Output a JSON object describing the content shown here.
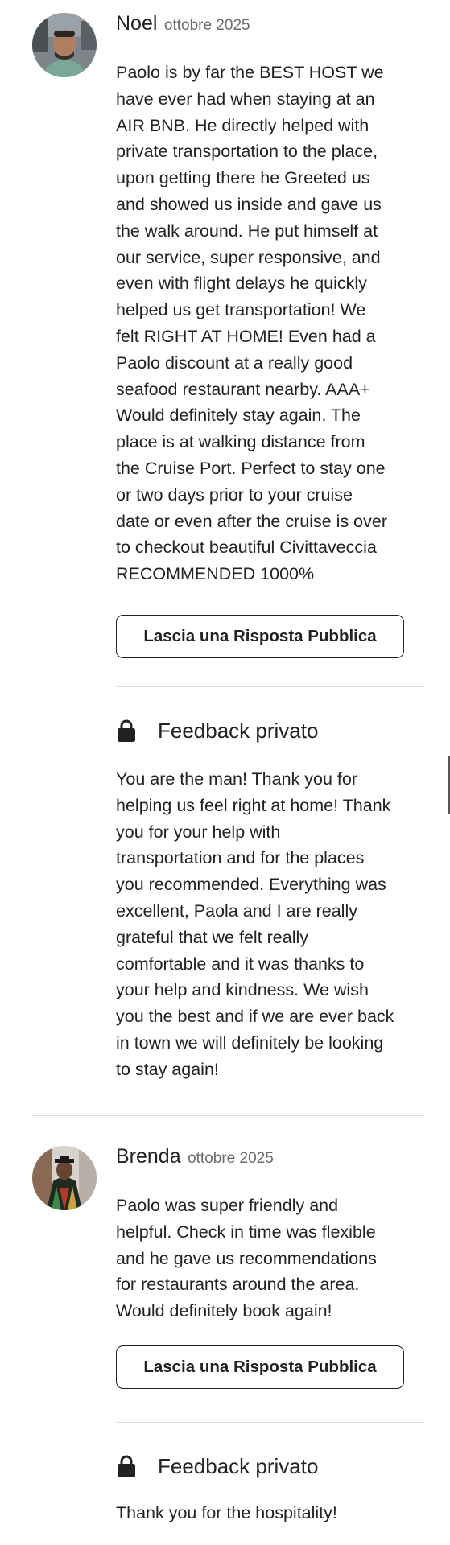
{
  "reviews": [
    {
      "reviewer": "Noel",
      "date": "ottobre 2025",
      "text": "Paolo is by far the BEST HOST we\nhave ever had when staying at an\nAIR BNB. He directly helped with\nprivate transportation to the place,\nupon getting there he Greeted us\nand showed us inside and gave us\nthe walk around. He put himself at\nour service, super responsive, and\neven with flight delays he quickly\nhelped us get transportation! We\nfelt RIGHT AT HOME! Even had a\nPaolo discount at a really good\nseafood restaurant nearby. AAA+\nWould definitely stay again. The\nplace is at walking distance from\nthe Cruise Port. Perfect to stay one\nor two days prior to your cruise\ndate or even after the cruise is over\nto checkout beautiful Civittaveccia\nRECOMMENDED 1000%",
      "reply_button": "Lascia una Risposta Pubblica",
      "private_feedback_title": "Feedback privato",
      "private_feedback": "You are the man! Thank you for\nhelping us feel right at home! Thank\nyou for your help with\ntransportation and for the places\nyou recommended. Everything was\nexcellent, Paola and I are really\ngrateful that we felt really\ncomfortable and it was thanks to\nyour help and kindness. We wish\nyou the best and if we are ever back\nin town we will definitely be looking\nto stay again!"
    },
    {
      "reviewer": "Brenda",
      "date": "ottobre 2025",
      "text": "Paolo was super friendly and\nhelpful. Check in time was flexible\nand he gave us recommendations\nfor restaurants around the area.\nWould definitely book again!",
      "reply_button": "Lascia una Risposta Pubblica",
      "private_feedback_title": "Feedback privato",
      "private_feedback": "Thank you for the hospitality!"
    }
  ],
  "colors": {
    "text": "#222222",
    "muted": "#6a6a6a",
    "divider": "#dddddd"
  }
}
